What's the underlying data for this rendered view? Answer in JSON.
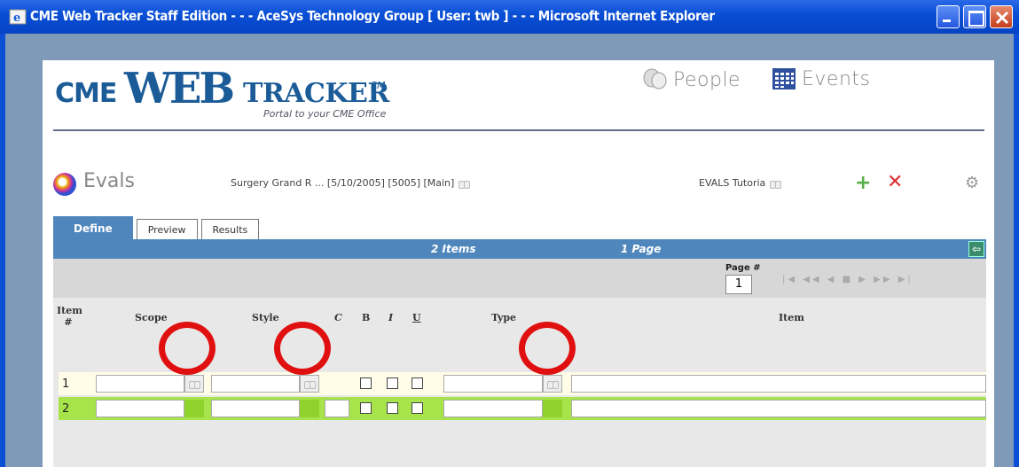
{
  "window": {
    "title": "CME Web Tracker Staff Edition - - - AceSys Technology Group [ User: twb ] - - - Microsoft Internet Explorer"
  },
  "logo": {
    "cme": "CME",
    "web": "WEB",
    "tracker": "TRACKER",
    "tm": "SM",
    "tagline": "Portal to your CME Office"
  },
  "nav": {
    "people": "People",
    "events": "Events"
  },
  "evals": {
    "label": "Evals",
    "current": "Surgery Grand R ... [5/10/2005] [5005] [Main]",
    "tutorial": "EVALS Tutoria"
  },
  "tabs": [
    {
      "label": "Define",
      "active": true
    },
    {
      "label": "Preview",
      "active": false
    },
    {
      "label": "Results",
      "active": false
    }
  ],
  "summary": {
    "items": "2 Items",
    "pages": "1 Page"
  },
  "pager": {
    "label": "Page #",
    "value": "1",
    "controls": "|◀ ◀◀ ◀ ■ ▶ ▶▶ ▶|"
  },
  "grid": {
    "headers": {
      "item_no": "Item #",
      "scope": "Scope",
      "style": "Style",
      "c": "C",
      "b": "B",
      "i": "I",
      "u": "U",
      "type": "Type",
      "item": "Item"
    },
    "rows": [
      {
        "num": "1"
      },
      {
        "num": "2"
      }
    ]
  },
  "colors": {
    "titlebar": "#0a4fd6",
    "accent_blue": "#4f87bd",
    "selected_row": "#a7e34a",
    "highlight_circle": "#e01010"
  }
}
